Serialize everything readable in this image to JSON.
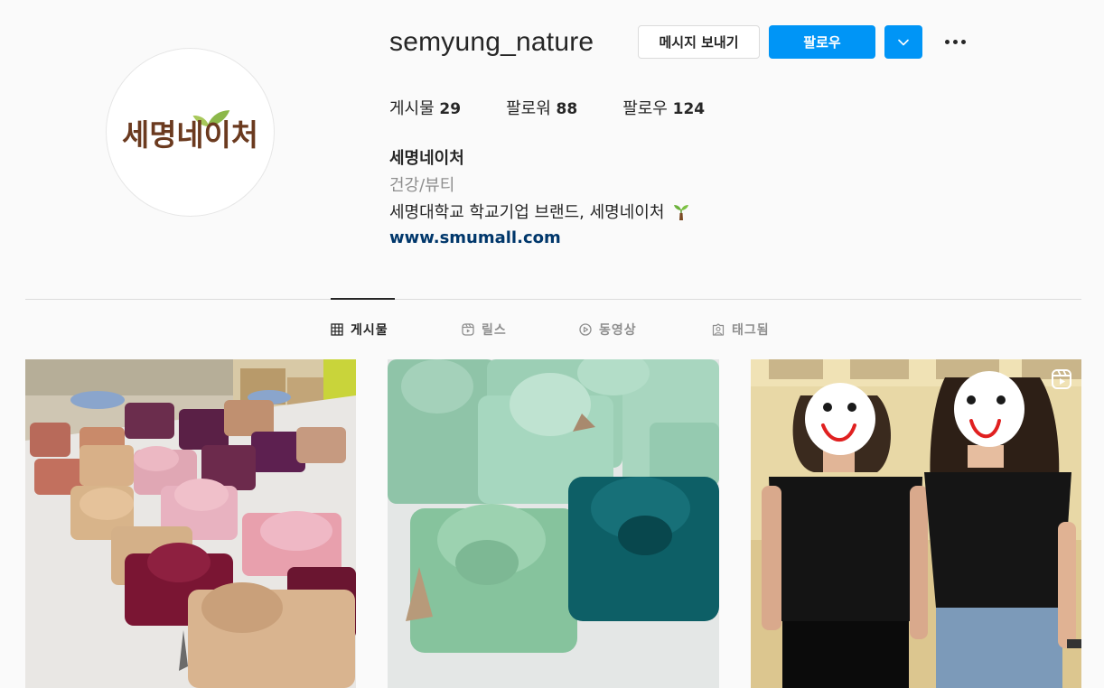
{
  "profile": {
    "username": "semyung_nature",
    "avatar_logo_text": "세명네이처",
    "full_name": "세명네이처",
    "category": "건강/뷰티",
    "bio": "세명대학교 학교기업 브랜드, 세명네이처",
    "bio_emoji": "seedling-icon",
    "website": "www.smumall.com"
  },
  "actions": {
    "message_label": "메시지 보내기",
    "follow_label": "팔로우",
    "dropdown_icon": "chevron-down-icon",
    "more_icon": "more-horizontal-icon"
  },
  "stats": {
    "posts_label": "게시물",
    "posts_count": "29",
    "followers_label": "팔로워",
    "followers_count": "88",
    "following_label": "팔로우",
    "following_count": "124"
  },
  "tabs": [
    {
      "label": "게시물",
      "icon": "grid-icon",
      "active": true
    },
    {
      "label": "릴스",
      "icon": "reels-icon",
      "active": false
    },
    {
      "label": "동영상",
      "icon": "video-icon",
      "active": false
    },
    {
      "label": "태그됨",
      "icon": "tagged-icon",
      "active": false
    }
  ],
  "posts": [
    {
      "description": "bojagi-wrapped gifts on table",
      "badge": ""
    },
    {
      "description": "green and teal bojagi-wrapped gifts",
      "badge": ""
    },
    {
      "description": "two people standing",
      "badge": "reels-icon"
    }
  ],
  "colors": {
    "background": "#fafafa",
    "accent": "#0095f6",
    "link": "#00376b",
    "muted": "#8e8e8e",
    "text": "#262626"
  }
}
